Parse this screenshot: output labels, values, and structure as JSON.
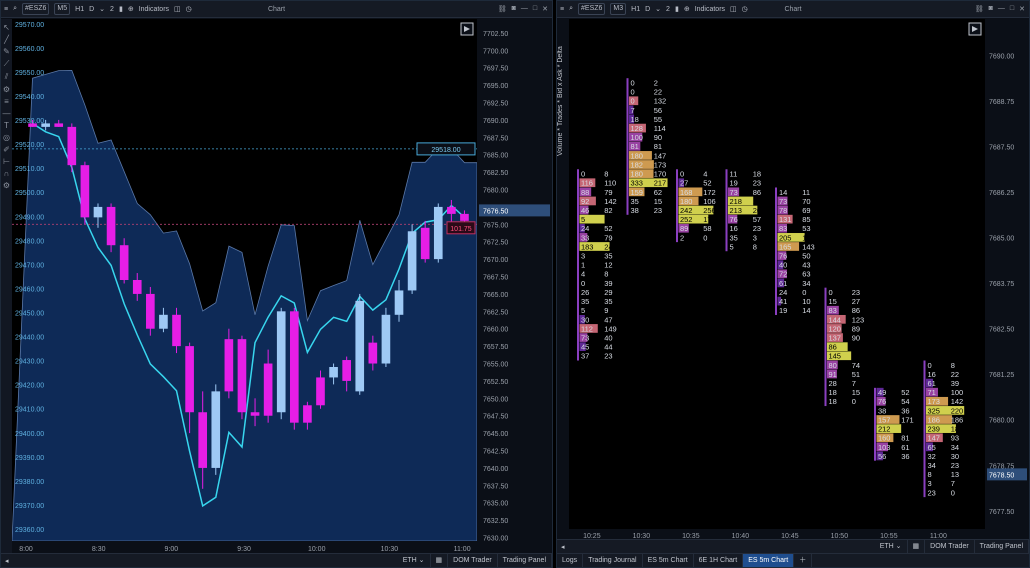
{
  "left": {
    "toolbar": {
      "symbol": "#ESZ6",
      "tf_m5": "M5",
      "tf_h1": "H1",
      "tf_d": "D",
      "count": "2",
      "indicators": "Indicators",
      "chart_title": "Chart"
    },
    "price_tag_line": "29518.00",
    "price_tag_current": "7676.50",
    "price_tag_delta": "101.75",
    "session": "ETH",
    "footer_tabs": [
      "DOM Trader",
      "Trading Panel"
    ]
  },
  "right": {
    "toolbar": {
      "symbol": "#ESZ6",
      "tf_m3": "M3",
      "tf_h1": "H1",
      "tf_d": "D",
      "count": "2",
      "indicators": "Indicators",
      "chart_title": "Chart"
    },
    "vertical_label": "Volume * Trades * Bid x Ask * Delta",
    "price_tag_current": "7678.50",
    "session": "ETH",
    "footer_tabs": [
      "DOM Trader",
      "Trading Panel"
    ],
    "y_ticks": [
      "7690.00",
      "7688.75",
      "7687.50",
      "7686.25",
      "7685.00",
      "7683.75",
      "7682.50",
      "7681.25",
      "7680.00",
      "7678.75",
      "7677.50"
    ],
    "x_ticks": [
      "10:25",
      "10:30",
      "10:35",
      "10:40",
      "10:45",
      "10:50",
      "10:55",
      "11:00"
    ]
  },
  "bottom_tabs": [
    "Logs",
    "Trading Journal",
    "ES 5m Chart",
    "6E 1H Chart",
    "ES 5m Chart"
  ],
  "bottom_active_tab": "ES 5m Chart",
  "chart_data": [
    {
      "type": "candlestick",
      "title": "",
      "left_axis_ticks": [
        "29570.00",
        "29560.00",
        "29550.00",
        "29540.00",
        "29530.00",
        "29520.00",
        "29510.00",
        "29500.00",
        "29490.00",
        "29480.00",
        "29470.00",
        "29460.00",
        "29450.00",
        "29440.00",
        "29430.00",
        "29420.00",
        "29410.00",
        "29400.00",
        "29390.00",
        "29380.00",
        "29370.00",
        "29360.00"
      ],
      "right_axis_ticks": [
        "7702.50",
        "7700.00",
        "7697.50",
        "7695.00",
        "7692.50",
        "7690.00",
        "7687.50",
        "7685.00",
        "7682.50",
        "7680.00",
        "7677.50",
        "7675.00",
        "7672.50",
        "7670.00",
        "7667.50",
        "7665.00",
        "7662.50",
        "7660.00",
        "7657.50",
        "7655.00",
        "7652.50",
        "7650.00",
        "7647.50",
        "7645.00",
        "7642.50",
        "7640.00",
        "7637.50",
        "7635.00",
        "7632.50",
        "7630.00"
      ],
      "x_ticks": [
        "8:00",
        "8:30",
        "9:00",
        "9:30",
        "10:00",
        "10:30",
        "11:00"
      ],
      "left_ylim": [
        29355,
        29572
      ],
      "right_ylim": [
        7629.5,
        7704.5
      ],
      "candles_right_scale": [
        {
          "o": 7689.5,
          "h": 7690.0,
          "l": 7689.0,
          "c": 7689.0,
          "color": "magenta"
        },
        {
          "o": 7689.0,
          "h": 7690.0,
          "l": 7688.5,
          "c": 7689.5,
          "color": "blue"
        },
        {
          "o": 7689.5,
          "h": 7690.0,
          "l": 7689.0,
          "c": 7689.0,
          "color": "magenta"
        },
        {
          "o": 7689.0,
          "h": 7689.5,
          "l": 7682.5,
          "c": 7683.5,
          "color": "magenta"
        },
        {
          "o": 7683.5,
          "h": 7684.0,
          "l": 7675.0,
          "c": 7676.0,
          "color": "magenta"
        },
        {
          "o": 7676.0,
          "h": 7678.0,
          "l": 7674.5,
          "c": 7677.5,
          "color": "blue"
        },
        {
          "o": 7677.5,
          "h": 7678.0,
          "l": 7671.0,
          "c": 7672.0,
          "color": "magenta"
        },
        {
          "o": 7672.0,
          "h": 7673.0,
          "l": 7666.5,
          "c": 7667.0,
          "color": "magenta"
        },
        {
          "o": 7667.0,
          "h": 7668.0,
          "l": 7664.0,
          "c": 7665.0,
          "color": "magenta"
        },
        {
          "o": 7665.0,
          "h": 7666.0,
          "l": 7659.0,
          "c": 7660.0,
          "color": "magenta"
        },
        {
          "o": 7660.0,
          "h": 7663.0,
          "l": 7659.5,
          "c": 7662.0,
          "color": "blue"
        },
        {
          "o": 7662.0,
          "h": 7663.0,
          "l": 7656.5,
          "c": 7657.5,
          "color": "magenta"
        },
        {
          "o": 7657.5,
          "h": 7658.0,
          "l": 7645.0,
          "c": 7648.0,
          "color": "magenta"
        },
        {
          "o": 7648.0,
          "h": 7651.0,
          "l": 7637.0,
          "c": 7640.0,
          "color": "magenta"
        },
        {
          "o": 7640.0,
          "h": 7652.0,
          "l": 7639.0,
          "c": 7651.0,
          "color": "blue"
        },
        {
          "o": 7651.0,
          "h": 7660.0,
          "l": 7650.0,
          "c": 7658.5,
          "color": "magenta"
        },
        {
          "o": 7658.5,
          "h": 7659.0,
          "l": 7647.0,
          "c": 7648.0,
          "color": "magenta"
        },
        {
          "o": 7648.0,
          "h": 7650.0,
          "l": 7646.0,
          "c": 7647.5,
          "color": "magenta"
        },
        {
          "o": 7647.5,
          "h": 7657.0,
          "l": 7646.5,
          "c": 7655.0,
          "color": "magenta"
        },
        {
          "o": 7648.0,
          "h": 7663.0,
          "l": 7647.0,
          "c": 7662.5,
          "color": "blue"
        },
        {
          "o": 7662.5,
          "h": 7663.0,
          "l": 7645.5,
          "c": 7646.5,
          "color": "magenta"
        },
        {
          "o": 7646.5,
          "h": 7649.5,
          "l": 7645.5,
          "c": 7649.0,
          "color": "magenta"
        },
        {
          "o": 7649.0,
          "h": 7654.0,
          "l": 7648.5,
          "c": 7653.0,
          "color": "magenta"
        },
        {
          "o": 7653.0,
          "h": 7655.0,
          "l": 7652.0,
          "c": 7654.5,
          "color": "blue"
        },
        {
          "o": 7652.5,
          "h": 7656.0,
          "l": 7651.0,
          "c": 7655.5,
          "color": "magenta"
        },
        {
          "o": 7651.0,
          "h": 7665.0,
          "l": 7650.5,
          "c": 7664.0,
          "color": "blue"
        },
        {
          "o": 7655.0,
          "h": 7659.0,
          "l": 7654.0,
          "c": 7658.0,
          "color": "magenta"
        },
        {
          "o": 7655.0,
          "h": 7663.0,
          "l": 7654.5,
          "c": 7662.0,
          "color": "blue"
        },
        {
          "o": 7662.0,
          "h": 7667.0,
          "l": 7661.0,
          "c": 7665.5,
          "color": "blue"
        },
        {
          "o": 7665.5,
          "h": 7675.0,
          "l": 7665.0,
          "c": 7674.0,
          "color": "blue"
        },
        {
          "o": 7670.0,
          "h": 7675.5,
          "l": 7669.5,
          "c": 7674.5,
          "color": "magenta"
        },
        {
          "o": 7670.0,
          "h": 7678.0,
          "l": 7669.5,
          "c": 7677.5,
          "color": "blue"
        },
        {
          "o": 7677.5,
          "h": 7678.5,
          "l": 7675.0,
          "c": 7676.5,
          "color": "magenta"
        },
        {
          "o": 7676.5,
          "h": 7677.0,
          "l": 7675.0,
          "c": 7675.5,
          "color": "magenta"
        }
      ],
      "indicator_band": "shaded envelope (dark blue) with cyan line overlay",
      "horizontal_lines": [
        {
          "value": 29518.0,
          "scale": "left"
        },
        {
          "value": 7675.0,
          "scale": "right"
        }
      ]
    },
    {
      "type": "footprint",
      "title": "",
      "ylim": [
        7677.0,
        7691.0
      ],
      "columns": [
        {
          "time": "10:25",
          "rows": [
            {
              "p": 7686.75,
              "bid": "0",
              "ask": "8"
            },
            {
              "p": 7686.5,
              "bid": "116",
              "ask": "110"
            },
            {
              "p": 7686.25,
              "bid": "88",
              "ask": "79"
            },
            {
              "p": 7686.0,
              "bid": "92",
              "ask": "142"
            },
            {
              "p": 7685.75,
              "bid": "46",
              "ask": "82"
            },
            {
              "p": 7685.5,
              "bid": "5",
              "ask": "353"
            },
            {
              "p": 7685.25,
              "bid": "24",
              "ask": "52"
            },
            {
              "p": 7685.0,
              "bid": "33",
              "ask": "79"
            },
            {
              "p": 7684.75,
              "bid": "183",
              "ask": "246"
            },
            {
              "p": 7684.5,
              "bid": "3",
              "ask": "35"
            },
            {
              "p": 7684.25,
              "bid": "1",
              "ask": "12"
            },
            {
              "p": 7684.0,
              "bid": "4",
              "ask": "8"
            },
            {
              "p": 7683.75,
              "bid": "0",
              "ask": "39"
            },
            {
              "p": 7683.5,
              "bid": "26",
              "ask": "29"
            },
            {
              "p": 7683.25,
              "bid": "35",
              "ask": "35"
            },
            {
              "p": 7683.0,
              "bid": "5",
              "ask": "9"
            },
            {
              "p": 7682.75,
              "bid": "30",
              "ask": "47"
            },
            {
              "p": 7682.5,
              "bid": "112",
              "ask": "149"
            },
            {
              "p": 7682.25,
              "bid": "73",
              "ask": "40"
            },
            {
              "p": 7682.0,
              "bid": "45",
              "ask": "44"
            },
            {
              "p": 7681.75,
              "bid": "37",
              "ask": "23"
            }
          ]
        },
        {
          "time": "10:30",
          "rows": [
            {
              "p": 7689.25,
              "bid": "0",
              "ask": "2"
            },
            {
              "p": 7689.0,
              "bid": "0",
              "ask": "22"
            },
            {
              "p": 7688.75,
              "bid": "0",
              "ask": "132"
            },
            {
              "p": 7688.5,
              "bid": "7",
              "ask": "56"
            },
            {
              "p": 7688.25,
              "bid": "18",
              "ask": "55"
            },
            {
              "p": 7688.0,
              "bid": "128",
              "ask": "114"
            },
            {
              "p": 7687.75,
              "bid": "100",
              "ask": "90"
            },
            {
              "p": 7687.5,
              "bid": "81",
              "ask": "81"
            },
            {
              "p": 7687.25,
              "bid": "180",
              "ask": "147"
            },
            {
              "p": 7687.0,
              "bid": "182",
              "ask": "173"
            },
            {
              "p": 7686.75,
              "bid": "180",
              "ask": "170"
            },
            {
              "p": 7686.5,
              "bid": "333",
              "ask": "217"
            },
            {
              "p": 7686.25,
              "bid": "159",
              "ask": "62"
            },
            {
              "p": 7686.0,
              "bid": "35",
              "ask": "15"
            },
            {
              "p": 7685.75,
              "bid": "38",
              "ask": "23"
            }
          ]
        },
        {
          "time": "10:35",
          "rows": [
            {
              "p": 7686.75,
              "bid": "0",
              "ask": "4"
            },
            {
              "p": 7686.5,
              "bid": "27",
              "ask": "52"
            },
            {
              "p": 7686.25,
              "bid": "168",
              "ask": "172"
            },
            {
              "p": 7686.0,
              "bid": "180",
              "ask": "106"
            },
            {
              "p": 7685.75,
              "bid": "242",
              "ask": "256"
            },
            {
              "p": 7685.5,
              "bid": "252",
              "ask": "173"
            },
            {
              "p": 7685.25,
              "bid": "89",
              "ask": "58"
            },
            {
              "p": 7685.0,
              "bid": "2",
              "ask": "0"
            }
          ]
        },
        {
          "time": "10:40",
          "rows": [
            {
              "p": 7686.75,
              "bid": "11",
              "ask": "18"
            },
            {
              "p": 7686.5,
              "bid": "19",
              "ask": "23"
            },
            {
              "p": 7686.25,
              "bid": "73",
              "ask": "86"
            },
            {
              "p": 7686.0,
              "bid": "218",
              "ask": "142"
            },
            {
              "p": 7685.75,
              "bid": "213",
              "ask": "206"
            },
            {
              "p": 7685.5,
              "bid": "76",
              "ask": "57"
            },
            {
              "p": 7685.25,
              "bid": "16",
              "ask": "23"
            },
            {
              "p": 7685.0,
              "bid": "35",
              "ask": "3"
            },
            {
              "p": 7684.75,
              "bid": "5",
              "ask": "8"
            }
          ]
        },
        {
          "time": "10:45",
          "rows": [
            {
              "p": 7686.25,
              "bid": "14",
              "ask": "11"
            },
            {
              "p": 7686.0,
              "bid": "73",
              "ask": "70"
            },
            {
              "p": 7685.75,
              "bid": "78",
              "ask": "69"
            },
            {
              "p": 7685.5,
              "bid": "131",
              "ask": "85"
            },
            {
              "p": 7685.25,
              "bid": "83",
              "ask": "53"
            },
            {
              "p": 7685.0,
              "bid": "205",
              "ask": "182"
            },
            {
              "p": 7684.75,
              "bid": "165",
              "ask": "143"
            },
            {
              "p": 7684.5,
              "bid": "76",
              "ask": "50"
            },
            {
              "p": 7684.25,
              "bid": "40",
              "ask": "43"
            },
            {
              "p": 7684.0,
              "bid": "72",
              "ask": "63"
            },
            {
              "p": 7683.75,
              "bid": "61",
              "ask": "34"
            },
            {
              "p": 7683.5,
              "bid": "24",
              "ask": "0"
            },
            {
              "p": 7683.25,
              "bid": "41",
              "ask": "10"
            },
            {
              "p": 7683.0,
              "bid": "19",
              "ask": "14"
            }
          ]
        },
        {
          "time": "10:50",
          "rows": [
            {
              "p": 7683.5,
              "bid": "0",
              "ask": "23"
            },
            {
              "p": 7683.25,
              "bid": "15",
              "ask": "27"
            },
            {
              "p": 7683.0,
              "bid": "83",
              "ask": "86"
            },
            {
              "p": 7682.75,
              "bid": "144",
              "ask": "123"
            },
            {
              "p": 7682.5,
              "bid": "120",
              "ask": "89"
            },
            {
              "p": 7682.25,
              "bid": "137",
              "ask": "90"
            },
            {
              "p": 7682.0,
              "bid": "86",
              "ask": "209"
            },
            {
              "p": 7681.75,
              "bid": "145",
              "ask": "200"
            },
            {
              "p": 7681.5,
              "bid": "80",
              "ask": "74"
            },
            {
              "p": 7681.25,
              "bid": "91",
              "ask": "51"
            },
            {
              "p": 7681.0,
              "bid": "28",
              "ask": "7"
            },
            {
              "p": 7680.75,
              "bid": "18",
              "ask": "15"
            },
            {
              "p": 7680.5,
              "bid": "18",
              "ask": "0"
            }
          ]
        },
        {
          "time": "10:55",
          "rows": [
            {
              "p": 7680.75,
              "bid": "49",
              "ask": "52"
            },
            {
              "p": 7680.5,
              "bid": "76",
              "ask": "54"
            },
            {
              "p": 7680.25,
              "bid": "38",
              "ask": "36"
            },
            {
              "p": 7680.0,
              "bid": "157",
              "ask": "171"
            },
            {
              "p": 7679.75,
              "bid": "212",
              "ask": "140"
            },
            {
              "p": 7679.5,
              "bid": "160",
              "ask": "81"
            },
            {
              "p": 7679.25,
              "bid": "103",
              "ask": "61"
            },
            {
              "p": 7679.0,
              "bid": "56",
              "ask": "36"
            }
          ]
        },
        {
          "time": "11:00",
          "rows": [
            {
              "p": 7681.5,
              "bid": "0",
              "ask": "8"
            },
            {
              "p": 7681.25,
              "bid": "16",
              "ask": "22"
            },
            {
              "p": 7681.0,
              "bid": "61",
              "ask": "39"
            },
            {
              "p": 7680.75,
              "bid": "71",
              "ask": "100"
            },
            {
              "p": 7680.5,
              "bid": "173",
              "ask": "142"
            },
            {
              "p": 7680.25,
              "bid": "325",
              "ask": "220"
            },
            {
              "p": 7680.0,
              "bid": "186",
              "ask": "186"
            },
            {
              "p": 7679.75,
              "bid": "239",
              "ask": "188"
            },
            {
              "p": 7679.5,
              "bid": "147",
              "ask": "93"
            },
            {
              "p": 7679.25,
              "bid": "65",
              "ask": "34"
            },
            {
              "p": 7679.0,
              "bid": "32",
              "ask": "30"
            },
            {
              "p": 7678.75,
              "bid": "34",
              "ask": "23"
            },
            {
              "p": 7678.5,
              "bid": "8",
              "ask": "13"
            },
            {
              "p": 7678.25,
              "bid": "3",
              "ask": "7"
            },
            {
              "p": 7678.0,
              "bid": "23",
              "ask": "0"
            }
          ]
        }
      ]
    }
  ]
}
